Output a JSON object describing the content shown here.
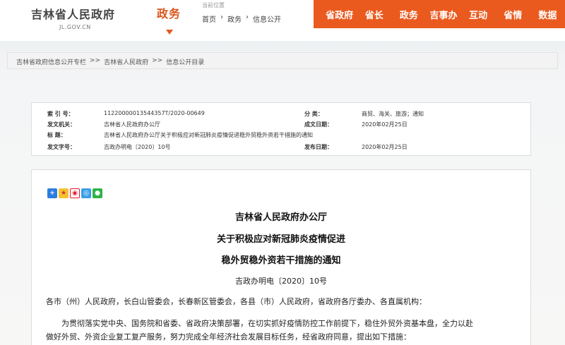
{
  "header": {
    "site_title": "吉林省人民政府",
    "site_url": "JL.GOV.CN",
    "section": "政务",
    "location_label": "当前位置",
    "location_crumbs": [
      "首页",
      "›",
      "政务",
      "›",
      "信息公开"
    ],
    "nav": [
      "省政府",
      "省长",
      "政务",
      "吉事办",
      "互动",
      "省情",
      "数据"
    ],
    "accent_color": "#ea5a1e"
  },
  "breadcrumb": [
    "吉林省政府信息公开专栏",
    ">>",
    "吉林省人民政府",
    ">>",
    "信息公开目录"
  ],
  "info": {
    "index_label": "索 引 号：",
    "index_value": "11220000013544357T/2020-00649",
    "category_label": "分 类：",
    "category_value": "商贸、海关、旅游；通知",
    "issuer_label": "发文机关：",
    "issuer_value": "吉林省人民政府办公厅",
    "written_label": "成文日期：",
    "written_value": "2020年02月25日",
    "title_label": "标 题：",
    "title_value": "吉林省人民政府办公厅关于积极应对新冠肺炎疫情促进稳外贸稳外资若干措施的通知",
    "docno_label": "发文字号：",
    "docno_value": "吉政办明电〔2020〕10号",
    "published_label": "发布日期：",
    "published_value": "2020年02月25日"
  },
  "share_icons": [
    "plus-share-icon",
    "qzone-icon",
    "weibo-icon",
    "tencent-icon",
    "wechat-icon"
  ],
  "article": {
    "heading1": "吉林省人民政府办公厅",
    "heading2": "关于积极应对新冠肺炎疫情促进",
    "heading3": "稳外贸稳外资若干措施的通知",
    "doc_number": "吉政办明电〔2020〕10号",
    "addressee": "各市（州）人民政府，长白山管委会，长春新区管委会，各县（市）人民政府，省政府各厅委办、各直属机构：",
    "body_line1": "为贯彻落实党中央、国务院和省委、省政府决策部署，在切实抓好疫情防控工作前提下，稳住外贸外资基本盘，全力以赴",
    "body_line2": "做好外贸、外资企业复工复产服务，努力完成全年经济社会发展目标任务，经省政府同意，提出如下措施："
  }
}
